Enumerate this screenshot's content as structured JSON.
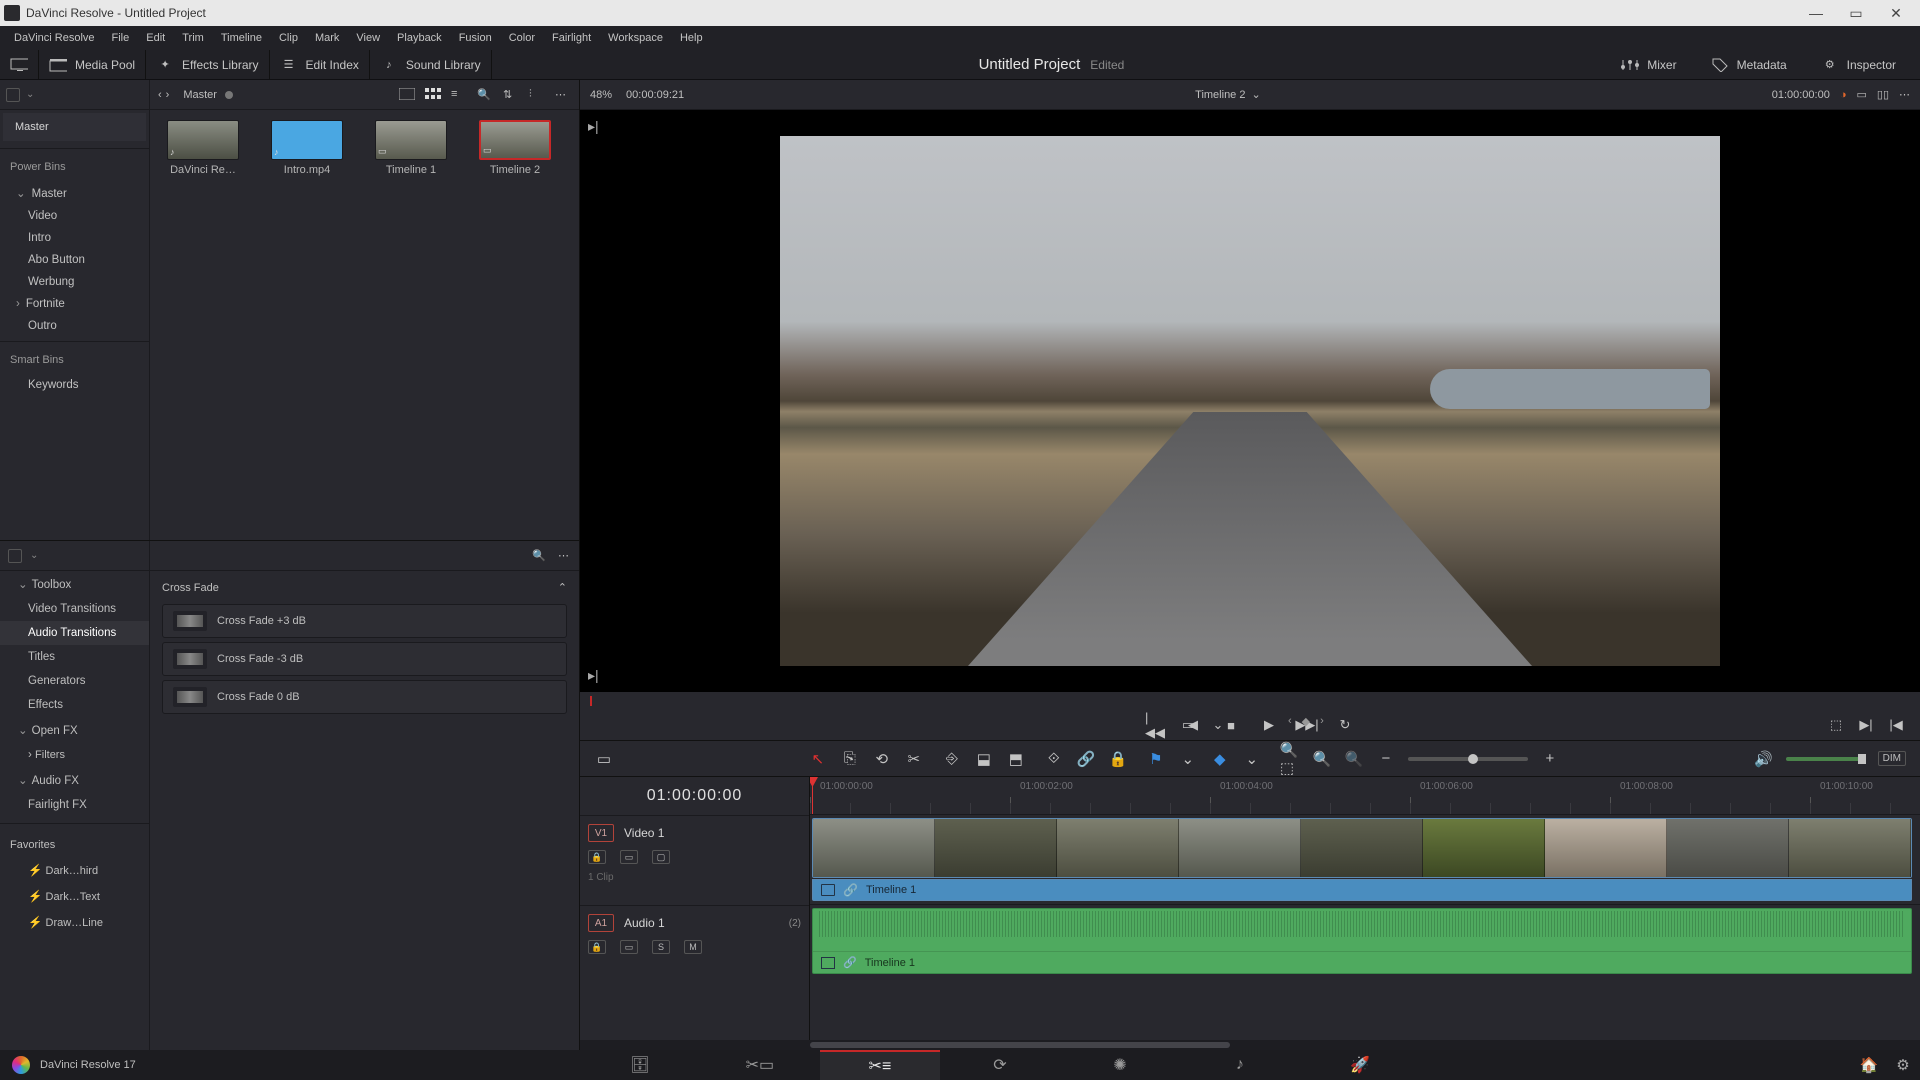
{
  "window": {
    "title": "DaVinci Resolve - Untitled Project"
  },
  "menubar": [
    "DaVinci Resolve",
    "File",
    "Edit",
    "Trim",
    "Timeline",
    "Clip",
    "Mark",
    "View",
    "Playback",
    "Fusion",
    "Color",
    "Fairlight",
    "Workspace",
    "Help"
  ],
  "toolbar": {
    "media_pool": "Media Pool",
    "effects_library": "Effects Library",
    "edit_index": "Edit Index",
    "sound_library": "Sound Library",
    "project_name": "Untitled Project",
    "project_status": "Edited",
    "mixer": "Mixer",
    "metadata": "Metadata",
    "inspector": "Inspector"
  },
  "media_pool": {
    "path": "Master",
    "zoom": "48%",
    "source_tc": "00:00:09:21",
    "sections": {
      "master": "Master",
      "power_bins": "Power Bins",
      "smart_bins": "Smart Bins"
    },
    "power_bin_items": [
      "Master",
      "Video",
      "Intro",
      "Abo Button",
      "Werbung",
      "Fortnite",
      "Outro"
    ],
    "smart_bin_items": [
      "Keywords"
    ],
    "clips": [
      {
        "name": "DaVinci Re…",
        "kind": "video"
      },
      {
        "name": "Intro.mp4",
        "kind": "solid"
      },
      {
        "name": "Timeline 1",
        "kind": "timeline"
      },
      {
        "name": "Timeline 2",
        "kind": "timeline"
      }
    ]
  },
  "viewer": {
    "timeline_name": "Timeline 2",
    "record_tc": "01:00:00:00"
  },
  "effects": {
    "group": "Cross Fade",
    "categories": {
      "toolbox": "Toolbox",
      "video_transitions": "Video Transitions",
      "audio_transitions": "Audio Transitions",
      "titles": "Titles",
      "generators": "Generators",
      "effects": "Effects",
      "open_fx": "Open FX",
      "filters": "Filters",
      "audio_fx": "Audio FX",
      "fairlight_fx": "Fairlight FX"
    },
    "favorites": {
      "header": "Favorites",
      "items": [
        "Dark…hird",
        "Dark…Text",
        "Draw…Line"
      ]
    },
    "items": [
      "Cross Fade +3 dB",
      "Cross Fade -3 dB",
      "Cross Fade 0 dB"
    ]
  },
  "timeline": {
    "tc": "01:00:00:00",
    "ticks": [
      "01:00:00:00",
      "01:00:02:00",
      "01:00:04:00",
      "01:00:06:00",
      "01:00:08:00",
      "01:00:10:00"
    ],
    "video_track": {
      "tag": "V1",
      "name": "Video 1",
      "clip_count": "1 Clip",
      "clip_name": "Timeline 1"
    },
    "audio_track": {
      "tag": "A1",
      "name": "Audio 1",
      "channels": "(2)",
      "clip_name": "Timeline 1",
      "solo": "S",
      "mute": "M"
    },
    "dim": "DIM"
  },
  "pages": {
    "brand": "DaVinci Resolve 17"
  }
}
